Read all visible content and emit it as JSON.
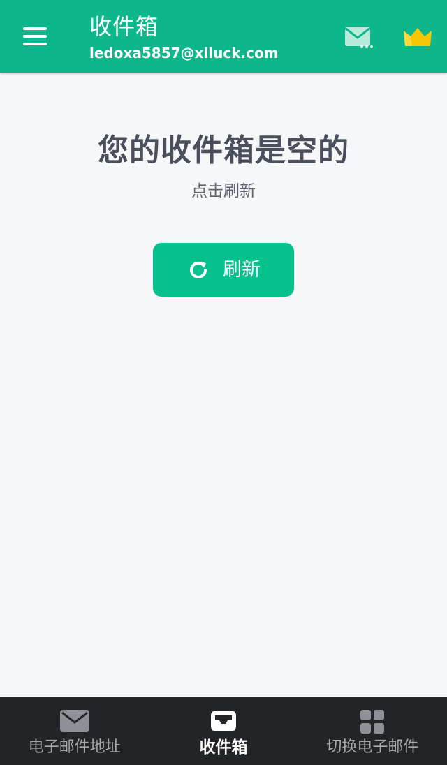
{
  "header": {
    "title": "收件箱",
    "email": "ledoxa5857@xlluck.com",
    "icons": {
      "menu": "hamburger-menu-icon",
      "mail": "mail-settings-icon",
      "premium": "crown-icon"
    }
  },
  "main": {
    "empty_title": "您的收件箱是空的",
    "empty_subtitle": "点击刷新",
    "refresh_label": "刷新",
    "refresh_icon": "refresh-icon"
  },
  "bottom_nav": {
    "items": [
      {
        "label": "电子邮件地址",
        "icon": "envelope-icon",
        "active": false
      },
      {
        "label": "收件箱",
        "icon": "inbox-tray-icon",
        "active": true
      },
      {
        "label": "切换电子邮件",
        "icon": "grid-icon",
        "active": false
      }
    ]
  },
  "colors": {
    "accent": "#0db68b",
    "button": "#06c08e",
    "background": "#f6f7f9",
    "nav_background": "#232428",
    "crown": "#f7c600"
  }
}
